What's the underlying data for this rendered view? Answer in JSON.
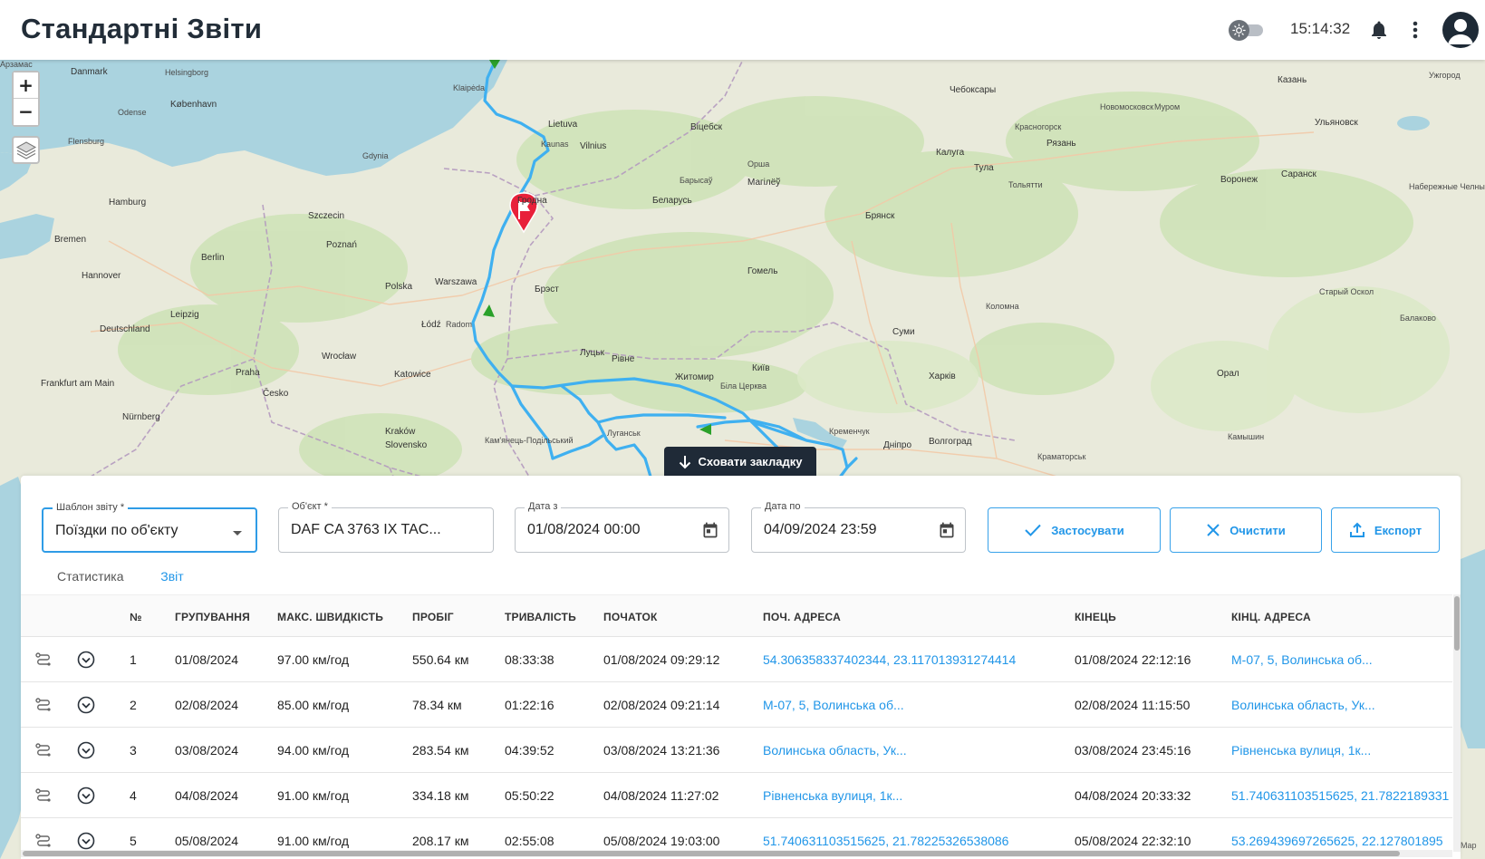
{
  "header": {
    "title": "Стандартні Звіти",
    "clock": "15:14:32"
  },
  "map": {
    "zoom_in": "+",
    "zoom_out": "−",
    "hide_tab_label": "Сховати закладку",
    "attribution": "Map",
    "labels": [
      {
        "t": "Danmark",
        "c": "city"
      },
      {
        "t": "København",
        "c": "city"
      },
      {
        "t": "Helsingborg",
        "c": ""
      },
      {
        "t": "Odense",
        "c": ""
      },
      {
        "t": "Flensburg",
        "c": ""
      },
      {
        "t": "Hamburg",
        "c": "city"
      },
      {
        "t": "Bremen",
        "c": "city"
      },
      {
        "t": "Hannover",
        "c": "city"
      },
      {
        "t": "Berlin",
        "c": "city"
      },
      {
        "t": "Leipzig",
        "c": "city"
      },
      {
        "t": "Deutschland",
        "c": "city"
      },
      {
        "t": "Frankfurt am Main",
        "c": "city"
      },
      {
        "t": "Nürnberg",
        "c": "city"
      },
      {
        "t": "Praha",
        "c": "city"
      },
      {
        "t": "Česko",
        "c": "city"
      },
      {
        "t": "Szczecin",
        "c": "city"
      },
      {
        "t": "Gdynia",
        "c": ""
      },
      {
        "t": "Poznań",
        "c": "city"
      },
      {
        "t": "Polska",
        "c": "city"
      },
      {
        "t": "Wrocław",
        "c": "city"
      },
      {
        "t": "Katowice",
        "c": "city"
      },
      {
        "t": "Kraków",
        "c": "city"
      },
      {
        "t": "Slovensko",
        "c": "city"
      },
      {
        "t": "Łódź",
        "c": "city"
      },
      {
        "t": "Warszawa",
        "c": "city"
      },
      {
        "t": "Radom",
        "c": ""
      },
      {
        "t": "Klaipėda",
        "c": ""
      },
      {
        "t": "Lietuva",
        "c": "city"
      },
      {
        "t": "Kaunas",
        "c": ""
      },
      {
        "t": "Vilnius",
        "c": "city"
      },
      {
        "t": "Гродна",
        "c": "city"
      },
      {
        "t": "Брэст",
        "c": "city"
      },
      {
        "t": "Беларусь",
        "c": "city"
      },
      {
        "t": "Барысаў",
        "c": ""
      },
      {
        "t": "Магілёў",
        "c": "city"
      },
      {
        "t": "Гомель",
        "c": "city"
      },
      {
        "t": "Віцебск",
        "c": "city"
      },
      {
        "t": "Орша",
        "c": ""
      },
      {
        "t": "Луцьк",
        "c": "city"
      },
      {
        "t": "Рівне",
        "c": "city"
      },
      {
        "t": "Житомир",
        "c": "city"
      },
      {
        "t": "Київ",
        "c": "city"
      },
      {
        "t": "Біла Церква",
        "c": ""
      },
      {
        "t": "Кременчук",
        "c": ""
      },
      {
        "t": "Дніпро",
        "c": "city"
      },
      {
        "t": "Харків",
        "c": "city"
      },
      {
        "t": "Суми",
        "c": "city"
      },
      {
        "t": "Брянск",
        "c": "city"
      },
      {
        "t": "Калуга",
        "c": "city"
      },
      {
        "t": "Тула",
        "c": "city"
      },
      {
        "t": "Рязань",
        "c": "city"
      },
      {
        "t": "Воронеж",
        "c": "city"
      },
      {
        "t": "Саранск",
        "c": "city"
      },
      {
        "t": "Ульяновск",
        "c": "city"
      },
      {
        "t": "Казань",
        "c": "city"
      },
      {
        "t": "Чебоксары",
        "c": "city"
      },
      {
        "t": "Красногорск",
        "c": ""
      },
      {
        "t": "Коломна",
        "c": ""
      },
      {
        "t": "Старый Оскол",
        "c": ""
      },
      {
        "t": "Балаково",
        "c": ""
      },
      {
        "t": "Орал",
        "c": "city"
      },
      {
        "t": "Камышин",
        "c": ""
      },
      {
        "t": "Волгоград",
        "c": "city"
      },
      {
        "t": "Краматорськ",
        "c": ""
      },
      {
        "t": "Луганськ",
        "c": ""
      },
      {
        "t": "Кам'янець-Подільський",
        "c": ""
      },
      {
        "t": "Ужгород",
        "c": ""
      },
      {
        "t": "Набережные Челны",
        "c": ""
      },
      {
        "t": "Тольятти",
        "c": ""
      },
      {
        "t": "Новомосковск",
        "c": ""
      },
      {
        "t": "Муром",
        "c": ""
      },
      {
        "t": "Арзамас",
        "c": ""
      }
    ]
  },
  "filters": {
    "template": {
      "label": "Шаблон звіту *",
      "value": "Поїздки по об'єкту"
    },
    "object": {
      "label": "Об'єкт *",
      "value": "DAF CA 3763 IX TAC..."
    },
    "date_from": {
      "label": "Дата з",
      "value": "01/08/2024 00:00"
    },
    "date_to": {
      "label": "Дата по",
      "value": "04/09/2024 23:59"
    },
    "apply_label": "Застосувати",
    "clear_label": "Очистити",
    "export_label": "Експорт"
  },
  "tabs": [
    {
      "label": "Статистика",
      "active": false
    },
    {
      "label": "Звіт",
      "active": true
    }
  ],
  "table": {
    "columns": [
      "№",
      "ГРУПУВАННЯ",
      "МАКС. ШВИДКІСТЬ",
      "ПРОБІГ",
      "ТРИВАЛІСТЬ",
      "ПОЧАТОК",
      "ПОЧ. АДРЕСА",
      "КІНЕЦЬ",
      "КІНЦ. АДРЕСА"
    ],
    "rows": [
      {
        "n": "1",
        "group": "01/08/2024",
        "speed": "97.00 км/год",
        "mileage": "550.64 км",
        "duration": "08:33:38",
        "start": "01/08/2024 09:29:12",
        "start_addr": "54.306358337402344, 23.117013931274414",
        "end": "01/08/2024 22:12:16",
        "end_addr": "М-07, 5, Волинська об..."
      },
      {
        "n": "2",
        "group": "02/08/2024",
        "speed": "85.00 км/год",
        "mileage": "78.34 км",
        "duration": "01:22:16",
        "start": "02/08/2024 09:21:14",
        "start_addr": "М-07, 5, Волинська об...",
        "end": "02/08/2024 11:15:50",
        "end_addr": "Волинська область, Ук..."
      },
      {
        "n": "3",
        "group": "03/08/2024",
        "speed": "94.00 км/год",
        "mileage": "283.54 км",
        "duration": "04:39:52",
        "start": "03/08/2024 13:21:36",
        "start_addr": "Волинська область, Ук...",
        "end": "03/08/2024 23:45:16",
        "end_addr": "Рівненська вулиця, 1к..."
      },
      {
        "n": "4",
        "group": "04/08/2024",
        "speed": "91.00 км/год",
        "mileage": "334.18 км",
        "duration": "05:50:22",
        "start": "04/08/2024 11:27:02",
        "start_addr": "Рівненська вулиця, 1к...",
        "end": "04/08/2024 20:33:32",
        "end_addr": "51.740631103515625, 21.7822189331"
      },
      {
        "n": "5",
        "group": "05/08/2024",
        "speed": "91.00 км/год",
        "mileage": "208.17 км",
        "duration": "02:55:08",
        "start": "05/08/2024 19:03:00",
        "start_addr": "51.740631103515625, 21.78225326538086",
        "end": "05/08/2024 22:32:10",
        "end_addr": "53.269439697265625, 22.127801895"
      }
    ]
  },
  "colors": {
    "accent": "#2196e8",
    "route": "#3fb0f0",
    "dark": "#1f2a37",
    "marker": "#e8203a"
  }
}
